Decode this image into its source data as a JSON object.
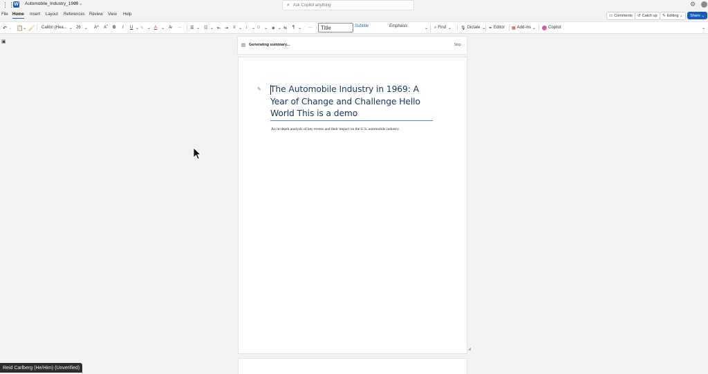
{
  "titlebar": {
    "doc_name": "Automobile_Industry_1969",
    "saved_indicator": "⟳ ⌄",
    "search_placeholder": "Ask Copilot anything"
  },
  "tabs": [
    {
      "label": "File"
    },
    {
      "label": "Home"
    },
    {
      "label": "Insert"
    },
    {
      "label": "Layout"
    },
    {
      "label": "References"
    },
    {
      "label": "Review"
    },
    {
      "label": "View"
    },
    {
      "label": "Help"
    }
  ],
  "right_actions": {
    "comments": "Comments",
    "catch_up": "Catch up",
    "editing": "Editing ⌄",
    "share": "Share ⌄"
  },
  "ribbon": {
    "font_name": "Calibri (Hea...",
    "font_size": "26",
    "style_title": "Title",
    "style_subtitle": "Subtitle",
    "style_emphasis": "Emphasis",
    "find": "Find",
    "dictate": "Dictate",
    "editor": "Editor",
    "addins": "Add-ins",
    "copilot": "Copilot"
  },
  "summary": {
    "text": "Generating summary...",
    "stop": "Stop"
  },
  "document": {
    "title": "The Automobile Industry in 1969: A Year of Change and Challenge Hello World This is a demo",
    "subtitle": "An in-depth analysis of key events and their impact on the U.S. automobile industry."
  },
  "presenter": {
    "name": "Reid Carlberg (He/Him) (Unverified)"
  },
  "colors": {
    "accent": "#185abd",
    "title_text": "#17365d",
    "title_rule": "#4f81bd"
  }
}
